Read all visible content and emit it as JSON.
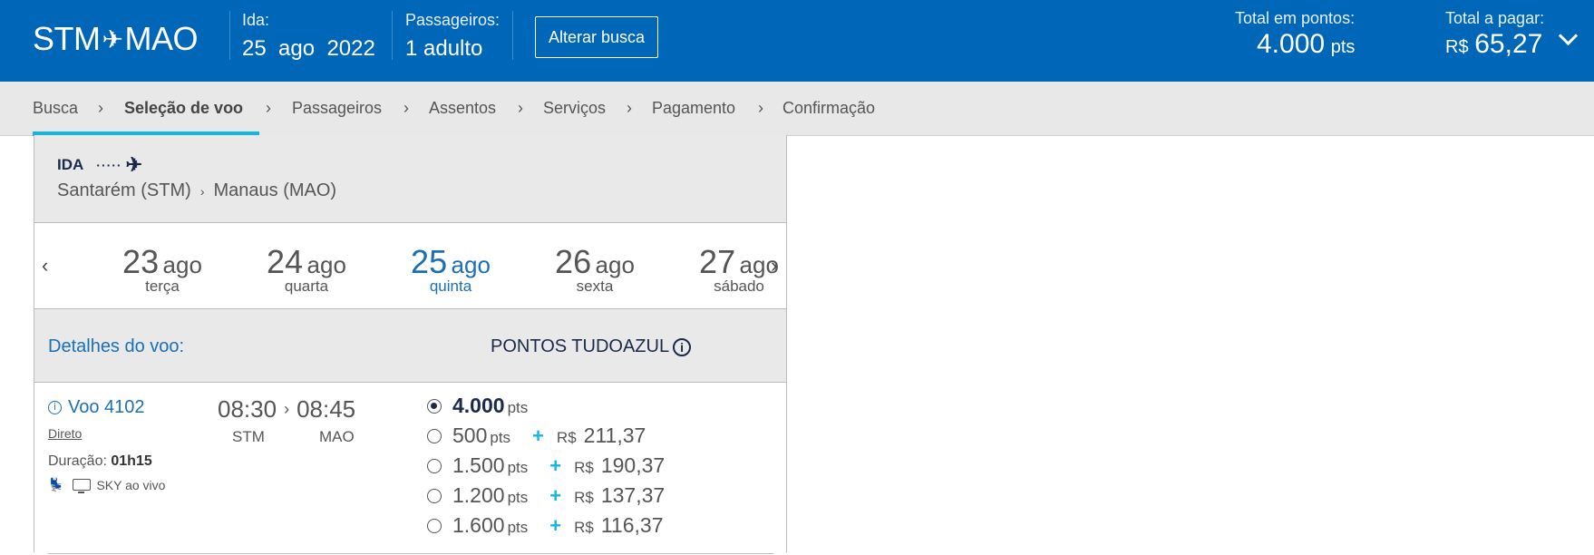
{
  "header": {
    "origin": "STM",
    "destination": "MAO",
    "ida_label": "Ida:",
    "ida_day": "25",
    "ida_month": "ago",
    "ida_year": "2022",
    "passengers_label": "Passageiros:",
    "passengers_value": "1 adulto",
    "change_search": "Alterar busca",
    "total_points_label": "Total em pontos:",
    "total_points_value": "4.000",
    "total_points_unit": "pts",
    "total_pay_label": "Total a pagar:",
    "total_pay_currency": "R$",
    "total_pay_value": "65,27"
  },
  "steps": [
    {
      "label": "Busca"
    },
    {
      "label": "Seleção de voo"
    },
    {
      "label": "Passageiros"
    },
    {
      "label": "Assentos"
    },
    {
      "label": "Serviços"
    },
    {
      "label": "Pagamento"
    },
    {
      "label": "Confirmação"
    }
  ],
  "active_step": "Seleção de voo",
  "leg": {
    "title": "IDA",
    "origin": "Santarém (STM)",
    "destination": "Manaus (MAO)"
  },
  "dates": [
    {
      "day": "23",
      "month": "ago",
      "weekday": "terça"
    },
    {
      "day": "24",
      "month": "ago",
      "weekday": "quarta"
    },
    {
      "day": "25",
      "month": "ago",
      "weekday": "quinta"
    },
    {
      "day": "26",
      "month": "ago",
      "weekday": "sexta"
    },
    {
      "day": "27",
      "month": "ago",
      "weekday": "sábado"
    }
  ],
  "selected_date": "25",
  "details": {
    "label": "Detalhes do voo:",
    "points_header": "PONTOS TUDOAZUL"
  },
  "flight": {
    "number": "Voo 4102",
    "type": "Direto",
    "duration_label": "Duração:",
    "duration": "01h15",
    "amenity": "SKY ao vivo",
    "depart_time": "08:30",
    "arrive_time": "08:45",
    "depart_code": "STM",
    "arrive_code": "MAO",
    "options": [
      {
        "points": "4.000",
        "unit": "pts",
        "currency": "",
        "money": "",
        "selected": true
      },
      {
        "points": "500",
        "unit": "pts",
        "currency": "R$",
        "money": "211,37",
        "selected": false
      },
      {
        "points": "1.500",
        "unit": "pts",
        "currency": "R$",
        "money": "190,37",
        "selected": false
      },
      {
        "points": "1.200",
        "unit": "pts",
        "currency": "R$",
        "money": "137,37",
        "selected": false
      },
      {
        "points": "1.600",
        "unit": "pts",
        "currency": "R$",
        "money": "116,37",
        "selected": false
      }
    ]
  },
  "colors": {
    "header_bg": "#0067b8",
    "accent_blue": "#1a6fb7",
    "step_underline": "#12b5e6",
    "plus": "#12b5e6",
    "panel_gray": "#e9e9e9"
  }
}
